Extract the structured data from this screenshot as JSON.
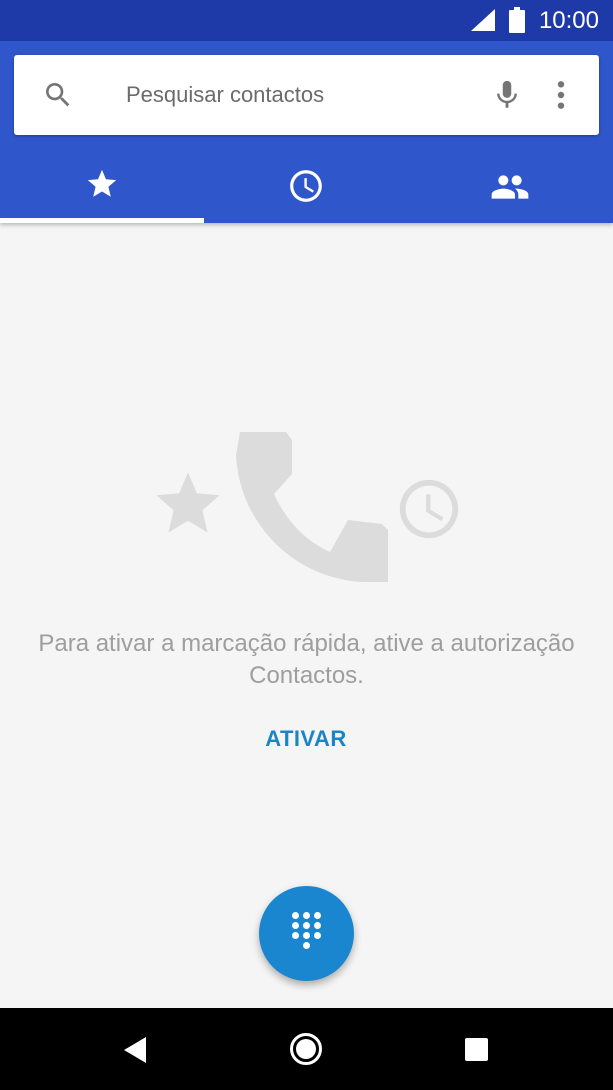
{
  "status_bar": {
    "time": "10:00"
  },
  "search": {
    "placeholder": "Pesquisar contactos"
  },
  "tabs": [
    {
      "name": "favorites",
      "icon": "star-icon",
      "selected": true
    },
    {
      "name": "recents",
      "icon": "clock-icon",
      "selected": false
    },
    {
      "name": "contacts",
      "icon": "people-icon",
      "selected": false
    }
  ],
  "empty_state": {
    "message": "Para ativar a marcação rápida, ative a autorização Contactos.",
    "action_label": "ATIVAR"
  },
  "fab": {
    "icon": "dialpad-icon"
  },
  "colors": {
    "status_bar": "#1e3aa8",
    "app_bar": "#2f57cb",
    "accent": "#1a86c8",
    "background": "#f5f5f5"
  }
}
